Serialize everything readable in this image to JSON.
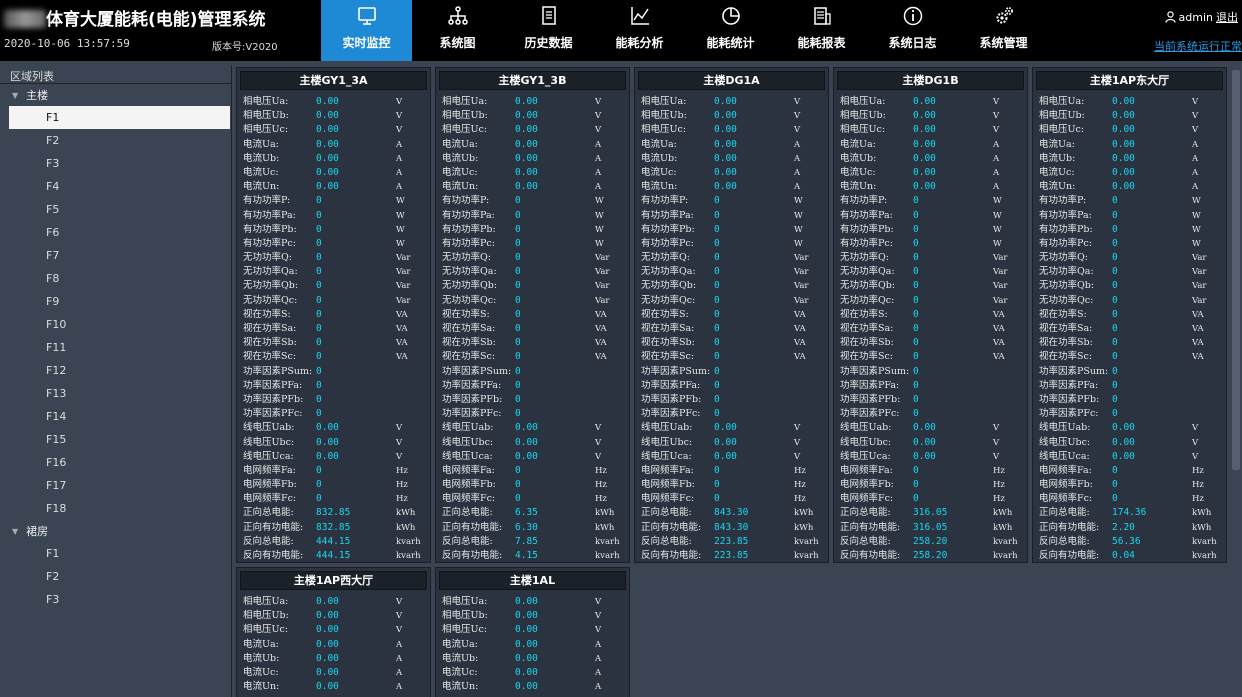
{
  "header": {
    "title": "体育大厦能耗(电能)管理系统",
    "datetime": "2020-10-06 13:57:59",
    "version": "版本号:V2020",
    "user": "admin",
    "logout": "退出",
    "run_status": "当前系统运行正常"
  },
  "nav": [
    {
      "label": "实时监控",
      "icon": "monitor-icon",
      "active": true
    },
    {
      "label": "系统图",
      "icon": "hierarchy-icon",
      "active": false
    },
    {
      "label": "历史数据",
      "icon": "document-icon",
      "active": false
    },
    {
      "label": "能耗分析",
      "icon": "line-chart-icon",
      "active": false
    },
    {
      "label": "能耗统计",
      "icon": "pie-chart-icon",
      "active": false
    },
    {
      "label": "能耗报表",
      "icon": "report-icon",
      "active": false
    },
    {
      "label": "系统日志",
      "icon": "info-icon",
      "active": false
    },
    {
      "label": "系统管理",
      "icon": "gears-icon",
      "active": false
    }
  ],
  "sidebar": {
    "title": "区域列表",
    "groups": [
      {
        "label": "主楼",
        "items": [
          "F1",
          "F2",
          "F3",
          "F4",
          "F5",
          "F6",
          "F7",
          "F8",
          "F9",
          "F10",
          "F11",
          "F12",
          "F13",
          "F14",
          "F15",
          "F16",
          "F17",
          "F18"
        ],
        "selected": "F1"
      },
      {
        "label": "裙房",
        "items": [
          "F1",
          "F2",
          "F3"
        ]
      }
    ]
  },
  "labels": [
    "相电压Ua:",
    "相电压Ub:",
    "相电压Uc:",
    "电流Ua:",
    "电流Ub:",
    "电流Uc:",
    "电流Un:",
    "有功功率P:",
    "有功功率Pa:",
    "有功功率Pb:",
    "有功功率Pc:",
    "无功功率Q:",
    "无功功率Qa:",
    "无功功率Qb:",
    "无功功率Qc:",
    "视在功率S:",
    "视在功率Sa:",
    "视在功率Sb:",
    "视在功率Sc:",
    "功率因素PSum:",
    "功率因素PFa:",
    "功率因素PFb:",
    "功率因素PFc:",
    "线电压Uab:",
    "线电压Ubc:",
    "线电压Uca:",
    "电网频率Fa:",
    "电网频率Fb:",
    "电网频率Fc:",
    "正向总电能:",
    "正向有功电能:",
    "反向总电能:",
    "反向有功电能:"
  ],
  "units": [
    "V",
    "V",
    "V",
    "A",
    "A",
    "A",
    "A",
    "W",
    "W",
    "W",
    "W",
    "Var",
    "Var",
    "Var",
    "Var",
    "VA",
    "VA",
    "VA",
    "VA",
    "",
    "",
    "",
    "",
    "V",
    "V",
    "V",
    "Hz",
    "Hz",
    "Hz",
    "kWh",
    "kWh",
    "kvarh",
    "kvarh"
  ],
  "cards": [
    {
      "title": "主楼GY1_3A",
      "values": [
        "0.00",
        "0.00",
        "0.00",
        "0.00",
        "0.00",
        "0.00",
        "0.00",
        "0",
        "0",
        "0",
        "0",
        "0",
        "0",
        "0",
        "0",
        "0",
        "0",
        "0",
        "0",
        "0",
        "0",
        "0",
        "0",
        "0.00",
        "0.00",
        "0.00",
        "0",
        "0",
        "0",
        "832.85",
        "832.85",
        "444.15",
        "444.15"
      ]
    },
    {
      "title": "主楼GY1_3B",
      "values": [
        "0.00",
        "0.00",
        "0.00",
        "0.00",
        "0.00",
        "0.00",
        "0.00",
        "0",
        "0",
        "0",
        "0",
        "0",
        "0",
        "0",
        "0",
        "0",
        "0",
        "0",
        "0",
        "0",
        "0",
        "0",
        "0",
        "0.00",
        "0.00",
        "0.00",
        "0",
        "0",
        "0",
        "6.35",
        "6.30",
        "7.85",
        "4.15"
      ]
    },
    {
      "title": "主楼DG1A",
      "values": [
        "0.00",
        "0.00",
        "0.00",
        "0.00",
        "0.00",
        "0.00",
        "0.00",
        "0",
        "0",
        "0",
        "0",
        "0",
        "0",
        "0",
        "0",
        "0",
        "0",
        "0",
        "0",
        "0",
        "0",
        "0",
        "0",
        "0.00",
        "0.00",
        "0.00",
        "0",
        "0",
        "0",
        "843.30",
        "843.30",
        "223.85",
        "223.85"
      ]
    },
    {
      "title": "主楼DG1B",
      "values": [
        "0.00",
        "0.00",
        "0.00",
        "0.00",
        "0.00",
        "0.00",
        "0.00",
        "0",
        "0",
        "0",
        "0",
        "0",
        "0",
        "0",
        "0",
        "0",
        "0",
        "0",
        "0",
        "0",
        "0",
        "0",
        "0",
        "0.00",
        "0.00",
        "0.00",
        "0",
        "0",
        "0",
        "316.05",
        "316.05",
        "258.20",
        "258.20"
      ]
    },
    {
      "title": "主楼1AP东大厅",
      "values": [
        "0.00",
        "0.00",
        "0.00",
        "0.00",
        "0.00",
        "0.00",
        "0.00",
        "0",
        "0",
        "0",
        "0",
        "0",
        "0",
        "0",
        "0",
        "0",
        "0",
        "0",
        "0",
        "0",
        "0",
        "0",
        "0",
        "0.00",
        "0.00",
        "0.00",
        "0",
        "0",
        "0",
        "174.36",
        "2.20",
        "56.36",
        "0.04"
      ]
    },
    {
      "title": "主楼1AP西大厅",
      "values": [
        "0.00",
        "0.00",
        "0.00",
        "0.00",
        "0.00",
        "0.00",
        "0.00"
      ]
    },
    {
      "title": "主楼1AL",
      "values": [
        "0.00",
        "0.00",
        "0.00",
        "0.00",
        "0.00",
        "0.00",
        "0.00"
      ]
    }
  ]
}
